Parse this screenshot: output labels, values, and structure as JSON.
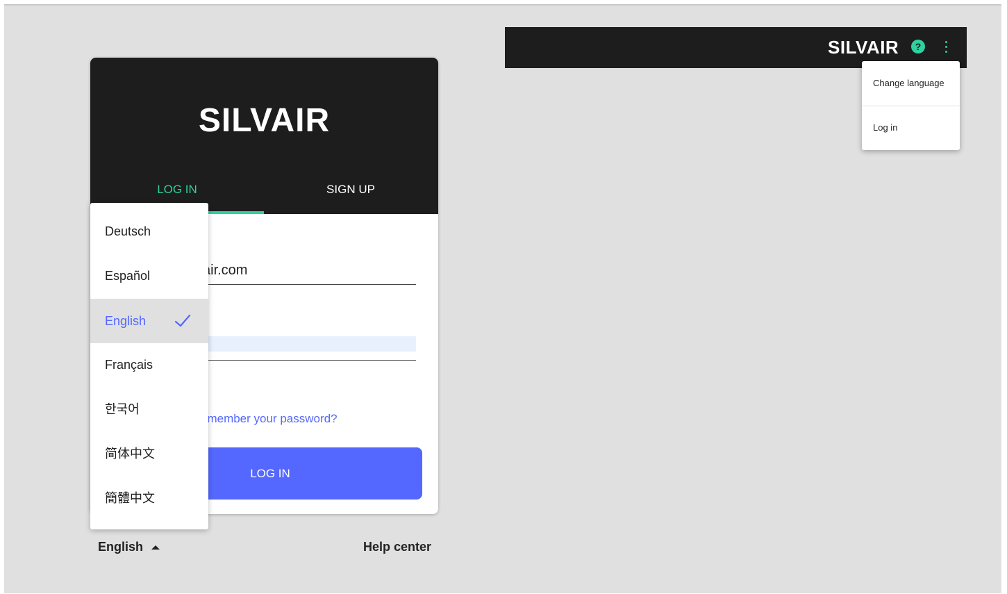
{
  "login_card": {
    "logo": "SILVAIR",
    "tabs": [
      {
        "label": "LOG IN",
        "active": true
      },
      {
        "label": "SIGN UP",
        "active": false
      }
    ],
    "email_value": "air.com",
    "forgot_link": "emember your password?",
    "login_button": "LOG IN"
  },
  "footer": {
    "language": "English",
    "help_center": "Help center"
  },
  "language_menu": {
    "items": [
      {
        "label": "Deutsch",
        "selected": false
      },
      {
        "label": "Español",
        "selected": false
      },
      {
        "label": "English",
        "selected": true
      },
      {
        "label": "Français",
        "selected": false
      },
      {
        "label": "한국어",
        "selected": false
      },
      {
        "label": "简体中文",
        "selected": false
      },
      {
        "label": "簡體中文",
        "selected": false
      }
    ]
  },
  "appbar": {
    "logo": "SILVAIR",
    "help_icon": "?",
    "menu_items": [
      {
        "label": "Change language"
      },
      {
        "label": "Log in"
      }
    ]
  },
  "colors": {
    "accent_green": "#2ed19f",
    "primary_blue": "#5468ff",
    "header_dark": "#1d1d1d",
    "background": "#e0e0e0"
  },
  "icons": [
    "check-icon",
    "caret-up-icon",
    "help-icon",
    "more-vert-icon"
  ]
}
